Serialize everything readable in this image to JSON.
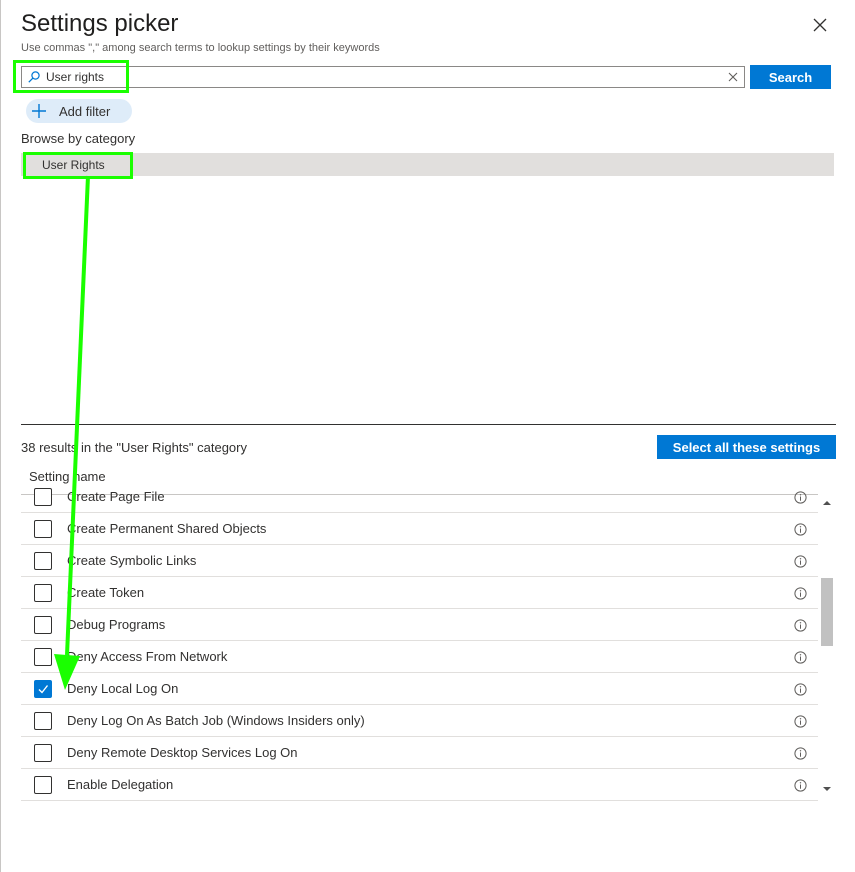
{
  "header": {
    "title": "Settings picker",
    "subtitle": "Use commas \",\" among search terms to lookup settings by their keywords",
    "close_icon": "close-icon"
  },
  "search": {
    "value": "User rights",
    "button_label": "Search"
  },
  "filter": {
    "add_label": "Add filter"
  },
  "browse": {
    "label": "Browse by category",
    "categories": [
      "User Rights"
    ]
  },
  "results": {
    "summary": "38 results in the \"User Rights\" category",
    "select_all_label": "Select all these settings",
    "column_header": "Setting name",
    "rows": [
      {
        "label": "Create Page File",
        "checked": false
      },
      {
        "label": "Create Permanent Shared Objects",
        "checked": false
      },
      {
        "label": "Create Symbolic Links",
        "checked": false
      },
      {
        "label": "Create Token",
        "checked": false
      },
      {
        "label": "Debug Programs",
        "checked": false
      },
      {
        "label": "Deny Access From Network",
        "checked": false
      },
      {
        "label": "Deny Local Log On",
        "checked": true
      },
      {
        "label": "Deny Log On As Batch Job (Windows Insiders only)",
        "checked": false
      },
      {
        "label": "Deny Remote Desktop Services Log On",
        "checked": false
      },
      {
        "label": "Enable Delegation",
        "checked": false
      }
    ]
  },
  "colors": {
    "accent": "#0078d4",
    "annotation": "#1aff00"
  }
}
